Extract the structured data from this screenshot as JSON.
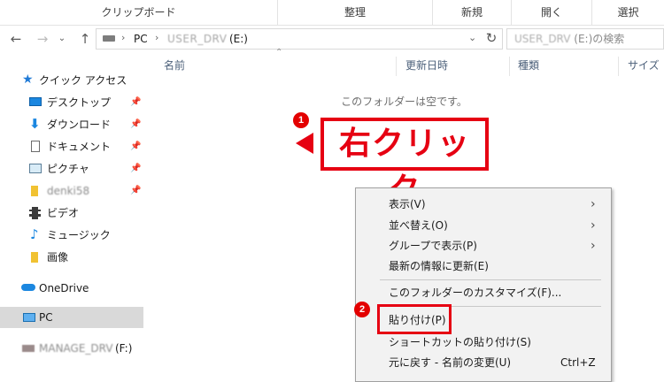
{
  "ribbon": {
    "groups": [
      "クリップボード",
      "整理",
      "新規",
      "開く",
      "選択"
    ]
  },
  "address": {
    "back_icon": "back-arrow-icon",
    "crumb_pc": "PC",
    "crumb_drive": "USER_DRV",
    "crumb_drive_suffix": "(E:)",
    "search_prefix": "USER_DRV",
    "search_suffix": "(E:)の検索"
  },
  "nav": {
    "quick_access": "クイック アクセス",
    "items": [
      {
        "label": "デスクトップ",
        "icon": "desktop-icon",
        "pinned": true
      },
      {
        "label": "ダウンロード",
        "icon": "download-icon",
        "pinned": true
      },
      {
        "label": "ドキュメント",
        "icon": "document-icon",
        "pinned": true
      },
      {
        "label": "ピクチャ",
        "icon": "picture-icon",
        "pinned": true
      },
      {
        "label": "denki58",
        "icon": "folder-icon",
        "pinned": true
      },
      {
        "label": "ビデオ",
        "icon": "video-icon",
        "pinned": false
      },
      {
        "label": "ミュージック",
        "icon": "music-icon",
        "pinned": false
      },
      {
        "label": "画像",
        "icon": "folder-icon",
        "pinned": false
      }
    ],
    "onedrive": "OneDrive",
    "pc": "PC",
    "manage_drive": "MANAGE_DRV",
    "manage_drive_suffix": "(F:)"
  },
  "columns": [
    "名前",
    "更新日時",
    "種類",
    "サイズ"
  ],
  "empty_message": "このフォルダーは空です。",
  "annotation": {
    "step1": "1",
    "step2": "2",
    "callout": "右クリック",
    "accent": "#e60012"
  },
  "context_menu": {
    "items": [
      {
        "label": "表示(V)",
        "submenu": true
      },
      {
        "label": "並べ替え(O)",
        "submenu": true
      },
      {
        "label": "グループで表示(P)",
        "submenu": true
      },
      {
        "label": "最新の情報に更新(E)",
        "submenu": false
      },
      {
        "label": "このフォルダーのカスタマイズ(F)...",
        "submenu": false
      },
      {
        "label": "貼り付け(P)",
        "submenu": false
      },
      {
        "label": "ショートカットの貼り付け(S)",
        "submenu": false
      },
      {
        "label": "元に戻す - 名前の変更(U)",
        "submenu": false,
        "shortcut": "Ctrl+Z"
      }
    ]
  }
}
